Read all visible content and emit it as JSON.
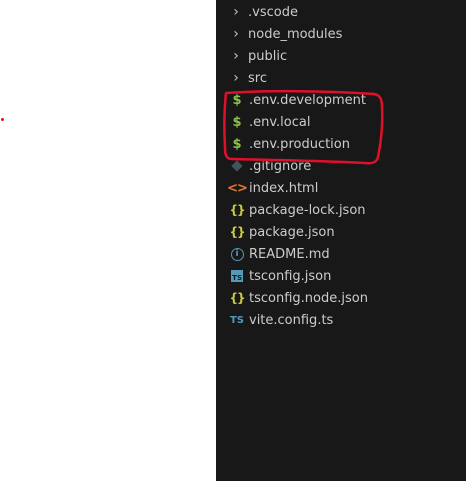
{
  "explorer": {
    "folders": [
      {
        "label": ".vscode",
        "icon": "chevron-right-icon"
      },
      {
        "label": "node_modules",
        "icon": "chevron-right-icon"
      },
      {
        "label": "public",
        "icon": "chevron-right-icon"
      },
      {
        "label": "src",
        "icon": "chevron-right-icon"
      }
    ],
    "files": [
      {
        "label": ".env.development",
        "icon": "env-dollar-icon",
        "glyph": "$"
      },
      {
        "label": ".env.local",
        "icon": "env-dollar-icon",
        "glyph": "$"
      },
      {
        "label": ".env.production",
        "icon": "env-dollar-icon",
        "glyph": "$"
      },
      {
        "label": ".gitignore",
        "icon": "git-icon"
      },
      {
        "label": "index.html",
        "icon": "html-icon",
        "glyph": "<>"
      },
      {
        "label": "package-lock.json",
        "icon": "json-icon",
        "glyph": "{}"
      },
      {
        "label": "package.json",
        "icon": "json-icon",
        "glyph": "{}"
      },
      {
        "label": "README.md",
        "icon": "info-icon",
        "glyph": "i"
      },
      {
        "label": "tsconfig.json",
        "icon": "tsconfig-icon",
        "glyph": "TS"
      },
      {
        "label": "tsconfig.node.json",
        "icon": "json-icon",
        "glyph": "{}"
      },
      {
        "label": "vite.config.ts",
        "icon": "typescript-icon",
        "glyph": "TS"
      }
    ],
    "chevron_glyph": "›"
  },
  "colors": {
    "panel_background": "#181818",
    "text": "#cccccc",
    "annotation_red": "#e0102a",
    "env_icon": "#8dc149",
    "html_icon": "#e37933",
    "json_icon": "#cbcb41",
    "ts_icon": "#519aba"
  }
}
